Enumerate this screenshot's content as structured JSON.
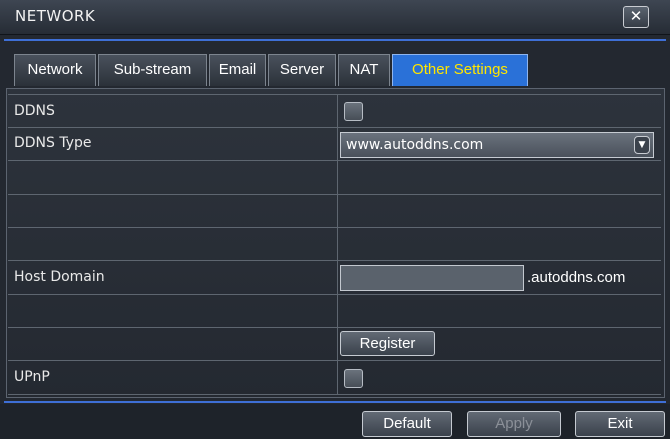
{
  "window": {
    "title": "NETWORK",
    "close_glyph": "✕",
    "close_icon": "close-icon"
  },
  "tabs": [
    {
      "label": "Network",
      "active": false
    },
    {
      "label": "Sub-stream",
      "active": false
    },
    {
      "label": "Email",
      "active": false
    },
    {
      "label": "Server",
      "active": false
    },
    {
      "label": "NAT",
      "active": false
    },
    {
      "label": "Other Settings",
      "active": true
    }
  ],
  "settings": {
    "ddns": {
      "label": "DDNS",
      "checked": false
    },
    "ddns_type": {
      "label": "DDNS Type",
      "value": "www.autoddns.com",
      "dropdown_icon": "chevron-down-icon"
    },
    "host_domain": {
      "label": "Host Domain",
      "value": "",
      "suffix": ".autoddns.com"
    },
    "register": {
      "label": "Register"
    },
    "upnp": {
      "label": "UPnP",
      "checked": false
    }
  },
  "footer": {
    "default_label": "Default",
    "apply_label": "Apply",
    "exit_label": "Exit"
  },
  "colors": {
    "accent": "#2a71d8",
    "active_tab_text": "#ffe600",
    "separator": "#3e6fd6"
  }
}
